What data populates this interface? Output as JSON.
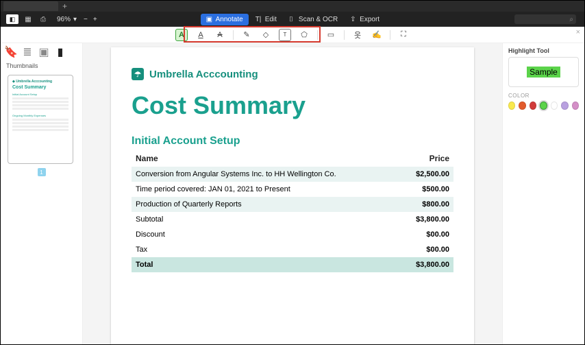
{
  "toolbar": {
    "zoom": "96%",
    "modes": {
      "annotate": "Annotate",
      "edit": "Edit",
      "scan": "Scan & OCR",
      "export": "Export"
    }
  },
  "left": {
    "thumbnails_label": "Thumbnails",
    "page_number": "1"
  },
  "document": {
    "company": "Umbrella Acccounting",
    "title": "Cost Summary",
    "section1": "Initial Account Setup",
    "headers": {
      "name": "Name",
      "price": "Price"
    },
    "rows": [
      {
        "name": "Conversion from Angular Systems Inc. to HH Wellington Co.",
        "price": "$2,500.00"
      },
      {
        "name": "Time period covered: JAN 01, 2021 to Present",
        "price": "$500.00"
      },
      {
        "name": "Production of Quarterly Reports",
        "price": "$800.00"
      }
    ],
    "summary": [
      {
        "label": "Subtotal",
        "value": "$3,800.00"
      },
      {
        "label": "Discount",
        "value": "$00.00"
      },
      {
        "label": "Tax",
        "value": "$00.00"
      },
      {
        "label": "Total",
        "value": "$3,800.00"
      }
    ]
  },
  "right": {
    "tool_title": "Highlight Tool",
    "sample": "Sample",
    "color_label": "COLOR",
    "colors": [
      "#f9e94e",
      "#e25b2c",
      "#d13b3b",
      "#5bd34a",
      "#ffffff",
      "#b9a1e0",
      "#d48fc7"
    ]
  }
}
